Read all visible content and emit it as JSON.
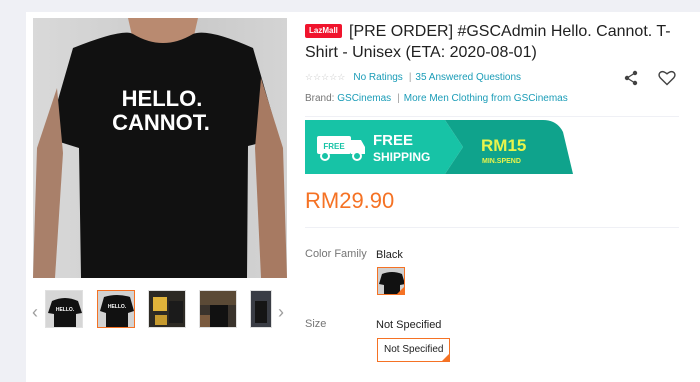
{
  "product": {
    "badge": "LazMall",
    "title": "[PRE ORDER] #GSCAdmin Hello. Cannot. T-Shirt - Unisex (ETA: 2020-08-01)",
    "shirt_text": "HELLO. CANNOT.",
    "rating_stars": "☆☆☆☆☆",
    "ratings_link": "No Ratings",
    "questions_link": "35 Answered Questions",
    "brand_label": "Brand:",
    "brand_link": "GSCinemas",
    "more_link": "More Men Clothing from GSCinemas",
    "price": "RM29.90"
  },
  "promo": {
    "free_shipping_word1": "FREE",
    "free_shipping_word2": "SHIPPING",
    "truck_text": "FREE",
    "amount": "RM15",
    "min_spend": "MIN.SPEND",
    "colors": {
      "teal": "#17c3a6",
      "dark": "#0fa38c"
    }
  },
  "options": {
    "color_label": "Color Family",
    "color_value": "Black",
    "size_label": "Size",
    "size_value": "Not Specified",
    "size_chip": "Not Specified"
  },
  "icons": [
    "chevron-left-icon",
    "chevron-right-icon",
    "share-icon",
    "heart-icon",
    "truck-icon"
  ],
  "accent": "#f57224"
}
